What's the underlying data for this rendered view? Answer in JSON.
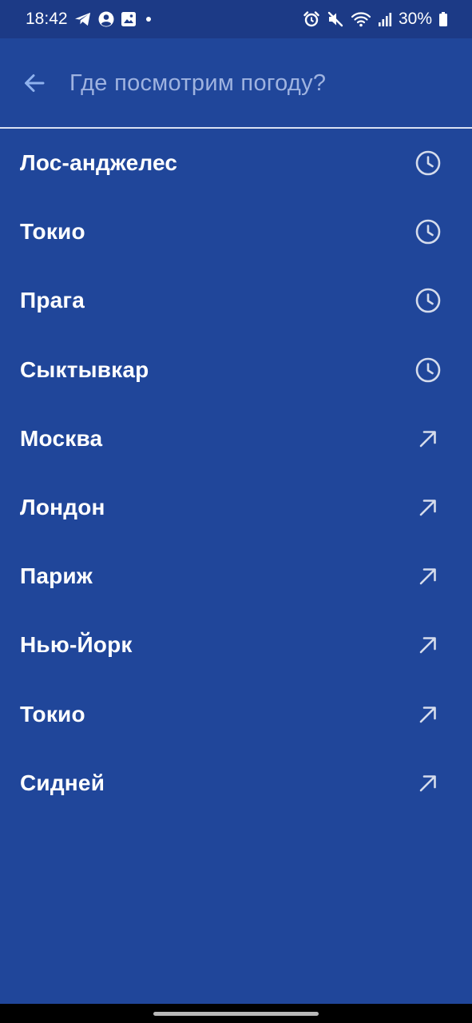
{
  "status_bar": {
    "time": "18:42",
    "battery": "30%",
    "left_icons": [
      "telegram-icon",
      "account-circle-icon",
      "gallery-icon",
      "notification-dot-icon"
    ],
    "right_icons": [
      "alarm-icon",
      "mute-icon",
      "wifi-icon",
      "signal-icon",
      "battery-icon"
    ]
  },
  "search": {
    "placeholder": "Где посмотрим погоду?",
    "value": ""
  },
  "colors": {
    "background": "#20469a",
    "status_bar": "#1c3a86",
    "divider": "#d9e1f3",
    "placeholder": "#9fb3e0",
    "text": "#ffffff"
  },
  "recent_cities": [
    {
      "name": "Лос-анджелес",
      "icon": "clock-icon"
    },
    {
      "name": "Токио",
      "icon": "clock-icon"
    },
    {
      "name": "Прага",
      "icon": "clock-icon"
    },
    {
      "name": "Сыктывкар",
      "icon": "clock-icon"
    }
  ],
  "suggested_cities": [
    {
      "name": "Москва",
      "icon": "arrow-up-right-icon"
    },
    {
      "name": "Лондон",
      "icon": "arrow-up-right-icon"
    },
    {
      "name": "Париж",
      "icon": "arrow-up-right-icon"
    },
    {
      "name": "Нью-Йорк",
      "icon": "arrow-up-right-icon"
    },
    {
      "name": "Токио",
      "icon": "arrow-up-right-icon"
    },
    {
      "name": "Сидней",
      "icon": "arrow-up-right-icon"
    }
  ]
}
